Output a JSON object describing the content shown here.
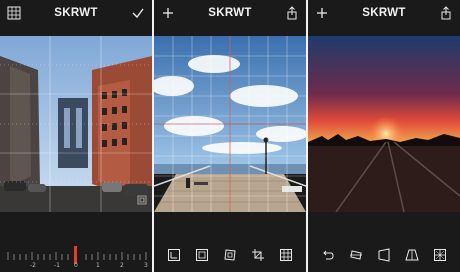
{
  "screens": [
    {
      "title": "SKRWT",
      "left_icon": "grid-icon",
      "right_icon": "checkmark-icon",
      "photo_subject": "",
      "ruler_labels": [
        "-2",
        "-1",
        "0",
        "1",
        "2",
        "3"
      ]
    },
    {
      "title": "SKRWT",
      "left_icon": "plus-icon",
      "right_icon": "share-icon"
    },
    {
      "title": "SKRWT",
      "left_icon": "plus-icon",
      "right_icon": "share-icon"
    }
  ],
  "toolbar_middle": [
    "lens-icon",
    "frame-icon",
    "perspective-icon",
    "crop-icon",
    "grid-icon"
  ],
  "toolbar_right": [
    "undo-icon",
    "rotate-icon",
    "vertical-perspective-icon",
    "horizontal-perspective-icon",
    "mirror-icon"
  ],
  "colors": {
    "bg": "#1a1a1a",
    "accent_red": "#e0402c"
  }
}
